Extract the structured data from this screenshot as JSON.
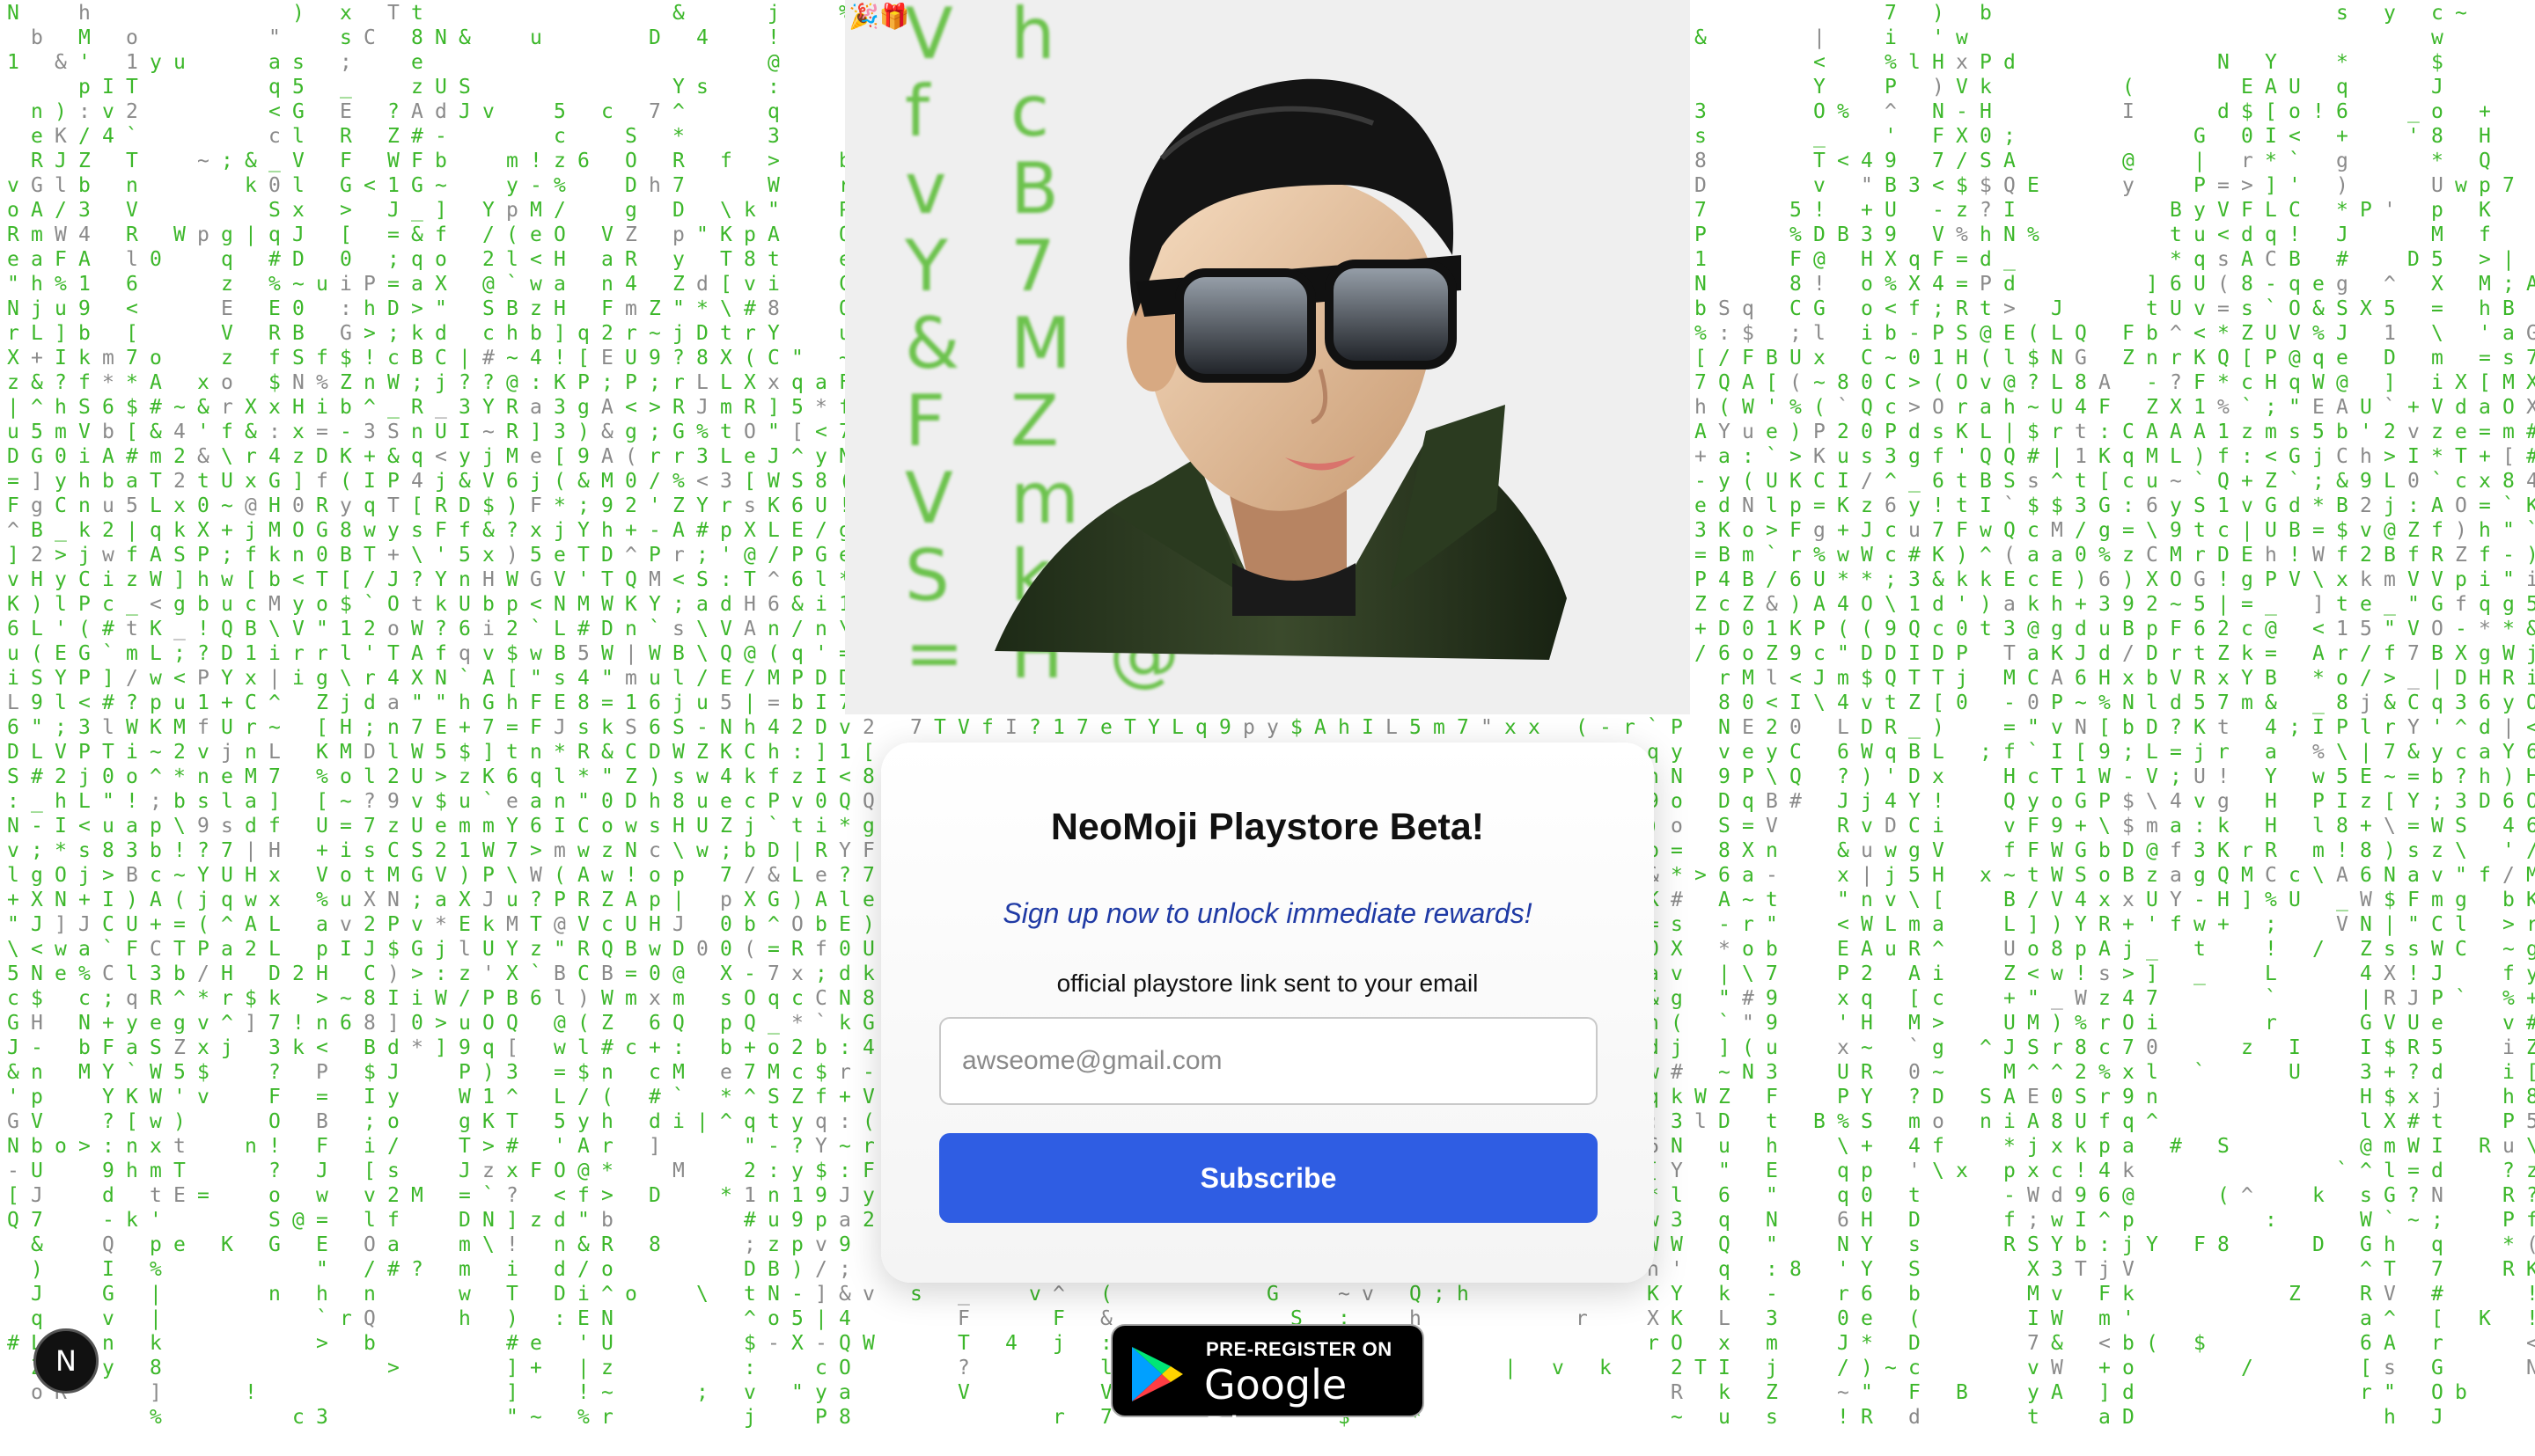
{
  "hero": {
    "emojis": "🎉🎁",
    "glyph_columns": [
      [
        "V",
        "f",
        "v",
        "Y",
        "&",
        "F",
        "V",
        "S",
        "="
      ],
      [
        "h",
        "c",
        "B",
        "7",
        "M",
        "Z",
        "m",
        "k",
        "H"
      ],
      [
        "",
        "",
        "",
        "",
        "",
        "",
        "",
        "",
        "@"
      ]
    ]
  },
  "card": {
    "title": "NeoMoji Playstore Beta!",
    "subtitle": "Sign up now to unlock immediate rewards!",
    "note": "official playstore link sent to your email",
    "email_placeholder": "awseome@gmail.com",
    "subscribe_label": "Subscribe"
  },
  "badge": {
    "line1": "PRE-REGISTER ON",
    "line2": "Google Play"
  },
  "fab": {
    "label": "N"
  },
  "colors": {
    "rain_green": "#3cb72a",
    "rain_gray": "#8a8a8a",
    "button_blue": "#2f5de3",
    "subtitle_blue": "#1f3aa5"
  }
}
